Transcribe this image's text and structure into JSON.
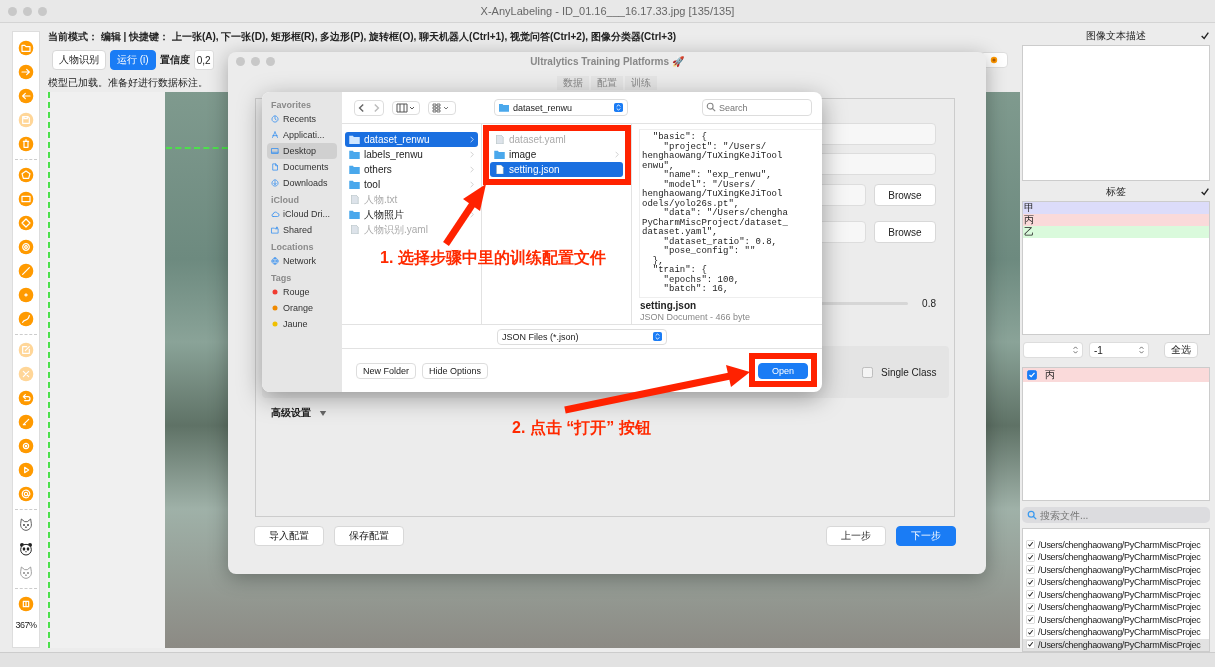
{
  "window": {
    "title": "X-AnyLabeling - ID_01.16___16.17.33.jpg [135/135]"
  },
  "mode_line": "当前模式： 编辑 | 快捷键： 上一张(A), 下一张(D), 矩形框(R), 多边形(P), 旋转框(O), 聊天机器人(Ctrl+1), 视觉问答(Ctrl+2), 图像分类器(Ctrl+3)",
  "toolbar": {
    "model_button": "人物识别",
    "run_button": "运行 (i)",
    "confidence_label": "置信度",
    "confidence_value": "0,2"
  },
  "status": "模型已加载。准备好进行数据标注。",
  "tools": [
    {
      "kind": "folder",
      "disabled": false
    },
    {
      "kind": "arrow-right",
      "disabled": false
    },
    {
      "kind": "arrow-left",
      "disabled": false
    },
    {
      "kind": "save",
      "disabled": true
    },
    {
      "kind": "trash",
      "disabled": false
    },
    {
      "kind": "separator"
    },
    {
      "kind": "polygon",
      "disabled": false
    },
    {
      "kind": "rectangle",
      "disabled": false
    },
    {
      "kind": "rotation",
      "disabled": false
    },
    {
      "kind": "circle",
      "disabled": false
    },
    {
      "kind": "line",
      "disabled": false
    },
    {
      "kind": "point",
      "disabled": false
    },
    {
      "kind": "linestrip",
      "disabled": false
    },
    {
      "kind": "separator"
    },
    {
      "kind": "edit",
      "disabled": true
    },
    {
      "kind": "cross",
      "disabled": true
    },
    {
      "kind": "undo",
      "disabled": false
    },
    {
      "kind": "brush",
      "disabled": false
    },
    {
      "kind": "target",
      "disabled": false
    },
    {
      "kind": "play",
      "disabled": false
    },
    {
      "kind": "at",
      "disabled": false
    },
    {
      "kind": "separator"
    },
    {
      "kind": "cat",
      "disabled": false
    },
    {
      "kind": "panda",
      "disabled": false
    },
    {
      "kind": "cat-outline",
      "disabled": false
    },
    {
      "kind": "separator"
    },
    {
      "kind": "square",
      "disabled": false
    }
  ],
  "zoom": "367%",
  "right_panel": {
    "description": {
      "title": "图像文本描述",
      "checked": true
    },
    "labels": {
      "title": "标签",
      "checked": true,
      "items": [
        {
          "name": "甲",
          "color": "#dcdcfa"
        },
        {
          "name": "丙",
          "color": "#fadada"
        },
        {
          "name": "乙",
          "color": "#dafadc"
        }
      ]
    },
    "spin_value": "-1",
    "select_all": "全选",
    "shapes": [
      {
        "name": "丙",
        "checked": true,
        "color": "#fadada"
      }
    ],
    "file_search": {
      "placeholder": "搜索文件..."
    },
    "files": [
      {
        "path": "/Users/chenghaowang/PyCharmMiscProjec",
        "checked": true,
        "selected": false
      },
      {
        "path": "/Users/chenghaowang/PyCharmMiscProjec",
        "checked": true,
        "selected": false
      },
      {
        "path": "/Users/chenghaowang/PyCharmMiscProjec",
        "checked": true,
        "selected": false
      },
      {
        "path": "/Users/chenghaowang/PyCharmMiscProjec",
        "checked": true,
        "selected": false
      },
      {
        "path": "/Users/chenghaowang/PyCharmMiscProjec",
        "checked": true,
        "selected": false
      },
      {
        "path": "/Users/chenghaowang/PyCharmMiscProjec",
        "checked": true,
        "selected": false
      },
      {
        "path": "/Users/chenghaowang/PyCharmMiscProjec",
        "checked": true,
        "selected": false
      },
      {
        "path": "/Users/chenghaowang/PyCharmMiscProjec",
        "checked": true,
        "selected": false
      },
      {
        "path": "/Users/chenghaowang/PyCharmMiscProjec",
        "checked": true,
        "selected": true
      }
    ]
  },
  "training_dialog": {
    "title": "Ultralytics Training Platforms 🚀",
    "tabs": [
      {
        "label": "数据",
        "selected": false
      },
      {
        "label": "配置",
        "selected": false
      },
      {
        "label": "训练",
        "selected": false
      }
    ],
    "fields": [
      {
        "kind": "text"
      },
      {
        "kind": "text"
      },
      {
        "kind": "path",
        "button": "Browse"
      },
      {
        "kind": "path",
        "button": "Browse"
      }
    ],
    "slider": {
      "level": 0.8,
      "reading": "0.8"
    },
    "single_class": {
      "label": "Single Class",
      "checked": false
    },
    "advanced": {
      "label": "高级设置",
      "expanded": false
    },
    "footer_buttons": [
      "导入配置",
      "保存配置"
    ],
    "back_button": "上一步",
    "next_button": "下一步"
  },
  "file_dialog": {
    "sidebar": [
      {
        "heading": "Favorites",
        "items": [
          {
            "label": "Recents",
            "kind": "clock",
            "selected": false
          },
          {
            "label": "Applicati...",
            "kind": "apps",
            "selected": false
          },
          {
            "label": "Desktop",
            "kind": "desktop",
            "selected": true
          },
          {
            "label": "Documents",
            "kind": "document",
            "selected": false
          },
          {
            "label": "Downloads",
            "kind": "download",
            "selected": false
          }
        ]
      },
      {
        "heading": "iCloud",
        "items": [
          {
            "label": "iCloud Dri...",
            "kind": "cloud",
            "selected": false
          },
          {
            "label": "Shared",
            "kind": "shared",
            "selected": false
          }
        ]
      },
      {
        "heading": "Locations",
        "items": [
          {
            "label": "Network",
            "kind": "globe",
            "selected": false
          }
        ]
      },
      {
        "heading": "Tags",
        "items": [
          {
            "label": "Rouge",
            "kind": "tag",
            "color": "#f03b30",
            "selected": false
          },
          {
            "label": "Orange",
            "kind": "tag",
            "color": "#f08a00",
            "selected": false
          },
          {
            "label": "Jaune",
            "kind": "tag",
            "color": "#f0c000",
            "selected": false
          }
        ]
      }
    ],
    "path_popup": "dataset_renwu",
    "search": {
      "placeholder": "Search"
    },
    "columns": [
      [
        {
          "name": "dataset_renwu",
          "kind": "folder",
          "disabled": false,
          "selected": true
        },
        {
          "name": "labels_renwu",
          "kind": "folder",
          "disabled": false,
          "selected": false
        },
        {
          "name": "others",
          "kind": "folder",
          "disabled": false,
          "selected": false
        },
        {
          "name": "tool",
          "kind": "folder",
          "disabled": false,
          "selected": false
        },
        {
          "name": "人物.txt",
          "kind": "file",
          "disabled": true,
          "selected": false
        },
        {
          "name": "人物照片",
          "kind": "folder",
          "disabled": false,
          "selected": false
        },
        {
          "name": "人物识别.yaml",
          "kind": "file",
          "disabled": true,
          "selected": false
        }
      ],
      [
        {
          "name": "dataset.yaml",
          "kind": "file",
          "disabled": true,
          "selected": false
        },
        {
          "name": "image",
          "kind": "folder",
          "disabled": false,
          "selected": false
        },
        {
          "name": "setting.json",
          "kind": "file",
          "disabled": false,
          "selected": true
        }
      ]
    ],
    "preview": {
      "lines": [
        "  \"basic\": {",
        "    \"project\": \"/Users/",
        "henghaowang/TuXingKeJiTool",
        "enwu\",",
        "    \"name\": \"exp_renwu\",",
        "    \"model\": \"/Users/",
        "henghaowang/TuXingKeJiTool",
        "odels/yolo26s.pt\",",
        "    \"data\": \"/Users/chengha",
        "PyCharmMiscProject/dataset_",
        "dataset.yaml\",",
        "    \"dataset_ratio\": 0.8,",
        "    \"pose_config\": \"\"",
        "  },",
        "  \"train\": {",
        "    \"epochs\": 100,",
        "    \"batch\": 16,"
      ],
      "name": "setting.json",
      "info": "JSON Document - 466 byte"
    },
    "filter": "JSON Files (*.json)",
    "buttons": [
      "New Folder",
      "Hide Options"
    ],
    "open_button": "Open"
  },
  "annotations": [
    {
      "text": "1. 选择步骤中里的训练配置文件"
    },
    {
      "text": "2. 点击 “打开” 按钮"
    }
  ]
}
